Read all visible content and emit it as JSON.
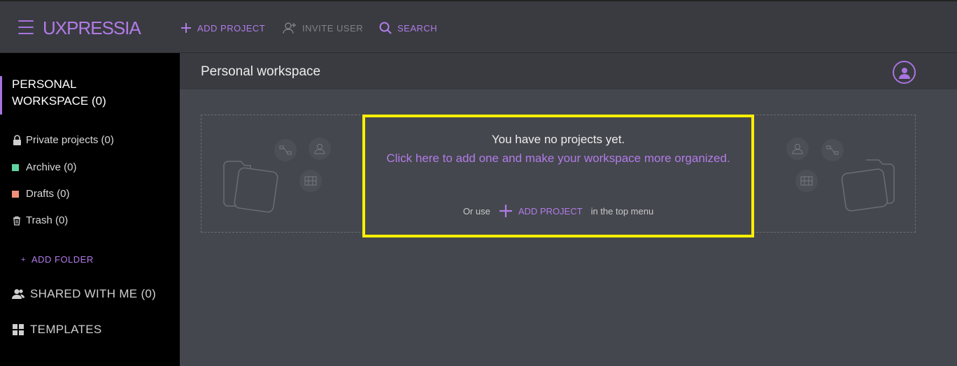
{
  "app": {
    "logo": "UXPRESSIA"
  },
  "topnav": {
    "add_project": "ADD PROJECT",
    "invite_user": "INVITE USER",
    "search": "SEARCH"
  },
  "sidebar": {
    "workspace_title_line1": "PERSONAL",
    "workspace_title_line2": "WORKSPACE (0)",
    "items": [
      {
        "label": "Private projects (0)",
        "icon": "lock-icon"
      },
      {
        "label": "Archive (0)",
        "color": "#5fd3a2"
      },
      {
        "label": "Drafts (0)",
        "color": "#f0907a"
      },
      {
        "label": "Trash (0)",
        "icon": "trash-icon"
      }
    ],
    "add_folder": "ADD FOLDER",
    "shared": "SHARED WITH ME (0)",
    "templates": "TEMPLATES"
  },
  "main": {
    "title": "Personal workspace",
    "empty_title": "You have no projects yet.",
    "empty_link": "Click here to add one and make your workspace more organized.",
    "hint_prefix": "Or use",
    "hint_button": "ADD PROJECT",
    "hint_suffix": "in the top menu"
  },
  "colors": {
    "accent": "#a874e0",
    "highlight": "#ffef00"
  }
}
